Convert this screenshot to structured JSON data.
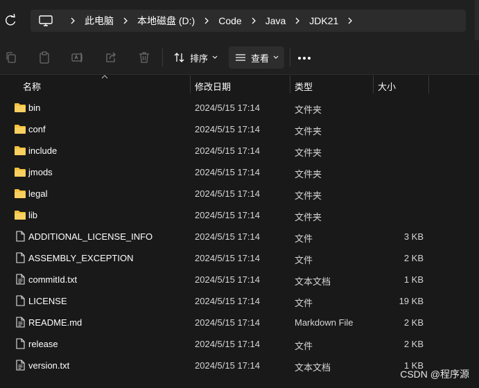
{
  "address": {
    "icon": "computer-icon",
    "crumbs": [
      "此电脑",
      "本地磁盘 (D:)",
      "Code",
      "Java",
      "JDK21"
    ]
  },
  "toolbar": {
    "sort_label": "排序",
    "view_label": "查看"
  },
  "columns": [
    "名称",
    "修改日期",
    "类型",
    "大小"
  ],
  "files": [
    {
      "name": "bin",
      "date": "2024/5/15 17:14",
      "type": "文件夹",
      "size": "",
      "icon": "folder-icon"
    },
    {
      "name": "conf",
      "date": "2024/5/15 17:14",
      "type": "文件夹",
      "size": "",
      "icon": "folder-icon"
    },
    {
      "name": "include",
      "date": "2024/5/15 17:14",
      "type": "文件夹",
      "size": "",
      "icon": "folder-icon"
    },
    {
      "name": "jmods",
      "date": "2024/5/15 17:14",
      "type": "文件夹",
      "size": "",
      "icon": "folder-icon"
    },
    {
      "name": "legal",
      "date": "2024/5/15 17:14",
      "type": "文件夹",
      "size": "",
      "icon": "folder-icon"
    },
    {
      "name": "lib",
      "date": "2024/5/15 17:14",
      "type": "文件夹",
      "size": "",
      "icon": "folder-icon"
    },
    {
      "name": "ADDITIONAL_LICENSE_INFO",
      "date": "2024/5/15 17:14",
      "type": "文件",
      "size": "3 KB",
      "icon": "file-icon"
    },
    {
      "name": "ASSEMBLY_EXCEPTION",
      "date": "2024/5/15 17:14",
      "type": "文件",
      "size": "2 KB",
      "icon": "file-icon"
    },
    {
      "name": "commitId.txt",
      "date": "2024/5/15 17:14",
      "type": "文本文档",
      "size": "1 KB",
      "icon": "text-file-icon"
    },
    {
      "name": "LICENSE",
      "date": "2024/5/15 17:14",
      "type": "文件",
      "size": "19 KB",
      "icon": "file-icon"
    },
    {
      "name": "README.md",
      "date": "2024/5/15 17:14",
      "type": "Markdown File",
      "size": "2 KB",
      "icon": "markdown-file-icon"
    },
    {
      "name": "release",
      "date": "2024/5/15 17:14",
      "type": "文件",
      "size": "2 KB",
      "icon": "file-icon"
    },
    {
      "name": "version.txt",
      "date": "2024/5/15 17:14",
      "type": "文本文档",
      "size": "1 KB",
      "icon": "text-file-icon"
    }
  ],
  "watermark": "CSDN @程序源",
  "colors": {
    "background": "#191919",
    "bar": "#202020",
    "folder": "#f4c23e"
  }
}
